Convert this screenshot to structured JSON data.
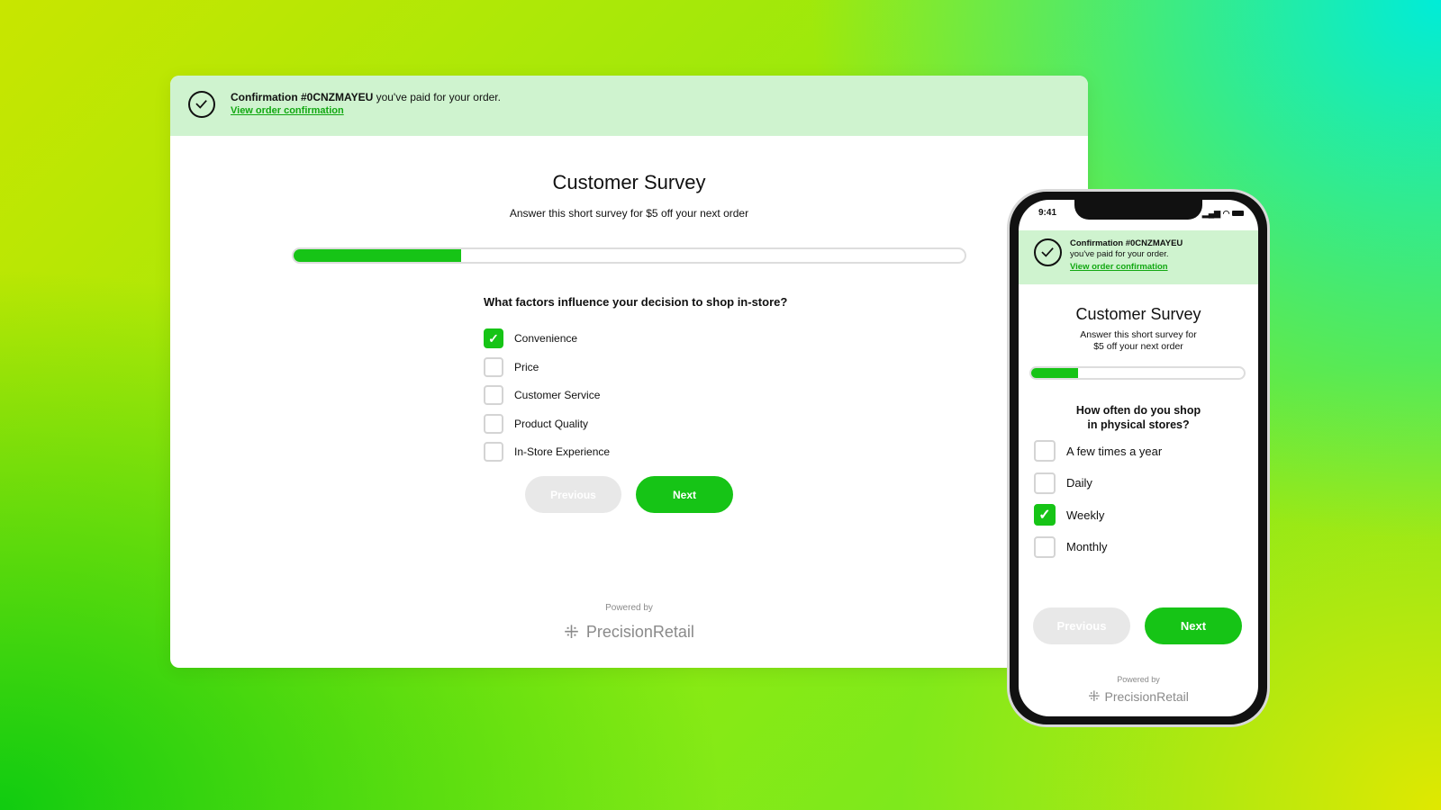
{
  "desktop": {
    "banner": {
      "confirmation_label": "Confirmation #0CNZMAYEU",
      "paid_text": " you've paid for your order.",
      "link": "View order confirmation",
      "icon": "check-circle-icon"
    },
    "title": "Customer Survey",
    "subtitle": "Answer this short survey for $5 off your next order",
    "progress_percent": 25,
    "question": "What factors influence your decision to shop in-store?",
    "options": [
      {
        "label": "Convenience",
        "checked": true
      },
      {
        "label": "Price",
        "checked": false
      },
      {
        "label": "Customer Service",
        "checked": false
      },
      {
        "label": "Product Quality",
        "checked": false
      },
      {
        "label": "In-Store Experience",
        "checked": false
      }
    ],
    "previous_label": "Previous",
    "next_label": "Next",
    "powered_by": "Powered by",
    "brand": "PrecisionRetail"
  },
  "mobile": {
    "time": "9:41",
    "banner": {
      "confirmation_label": "Confirmation #0CNZMAYEU",
      "paid_text": "you've paid for your order.",
      "link": "View order confirmation"
    },
    "title": "Customer Survey",
    "subtitle_line1": "Answer this short survey for",
    "subtitle_line2": "$5 off your next order",
    "progress_percent": 22,
    "question_line1": "How often do you shop",
    "question_line2": "in physical stores?",
    "options": [
      {
        "label": "A few times a year",
        "checked": false
      },
      {
        "label": "Daily",
        "checked": false
      },
      {
        "label": "Weekly",
        "checked": true
      },
      {
        "label": "Monthly",
        "checked": false
      }
    ],
    "previous_label": "Previous",
    "next_label": "Next",
    "powered_by": "Powered by",
    "brand": "PrecisionRetail"
  },
  "colors": {
    "accent": "#16c416",
    "banner": "#cff3cf"
  }
}
